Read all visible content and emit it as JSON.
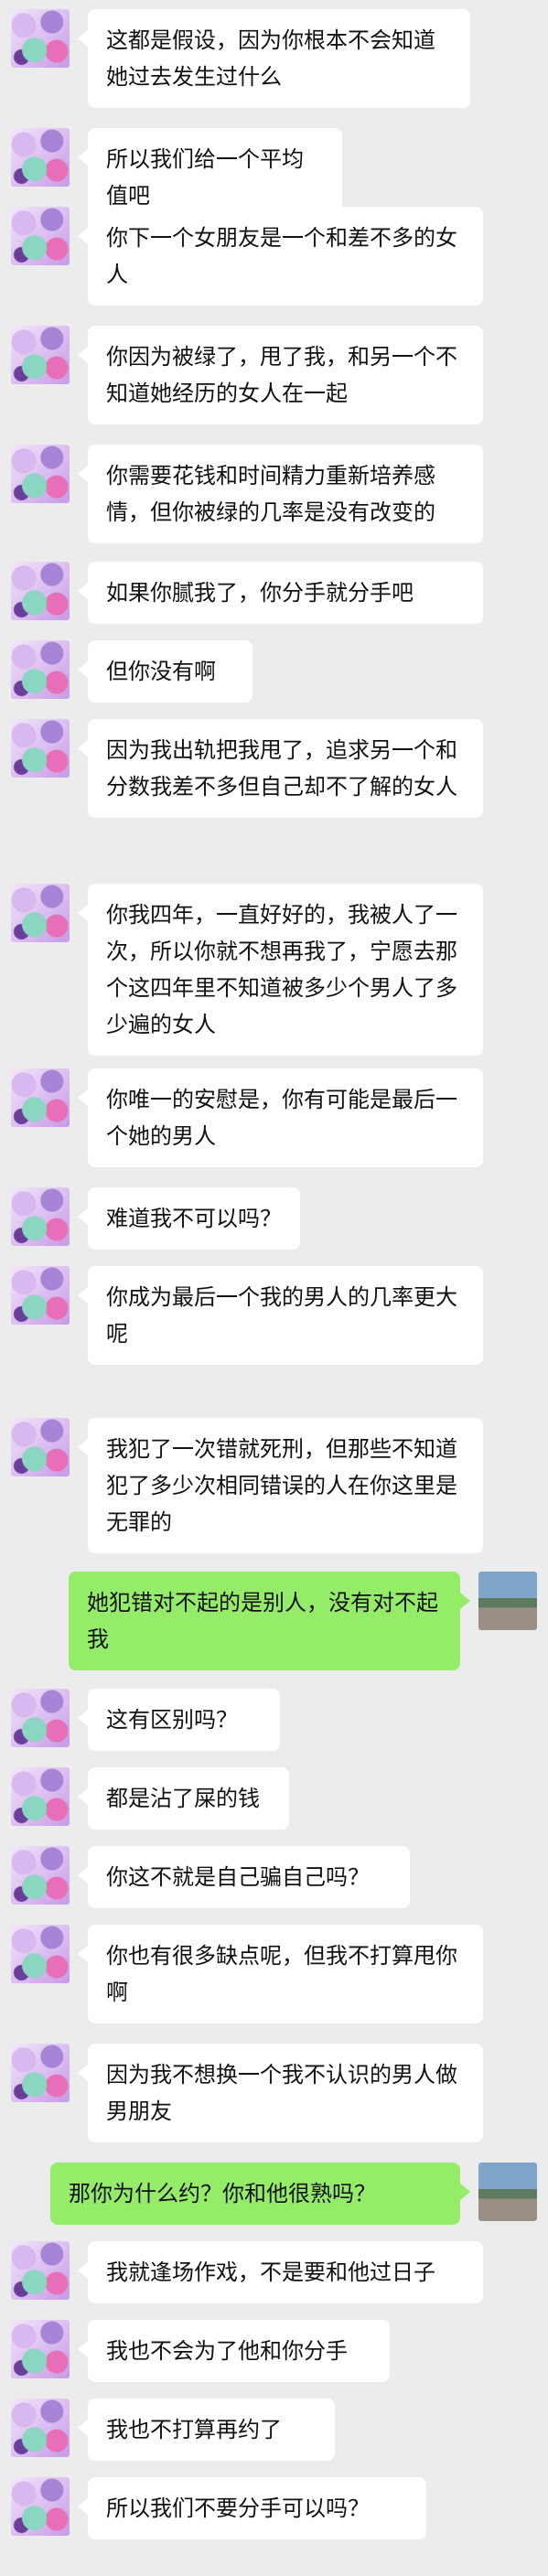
{
  "messages": [
    {
      "side": "left",
      "text": "这都是假设，因为你根本不会知道她过去发生过什么"
    },
    {
      "side": "left",
      "text": "所以我们给一个平均值吧"
    },
    {
      "side": "left",
      "text": "你下一个女朋友是一个和差不多的女人"
    },
    {
      "side": "left",
      "text": "你因为被绿了，甩了我，和另一个不知道她经历的女人在一起"
    },
    {
      "side": "left",
      "text": "你需要花钱和时间精力重新培养感情，但你被绿的几率是没有改变的"
    },
    {
      "side": "left",
      "text": "如果你腻我了，你分手就分手吧"
    },
    {
      "side": "left",
      "text": "但你没有啊"
    },
    {
      "side": "left",
      "text": "因为我出轨把我甩了，追求另一个和分数我差不多但自己却不了解的女人"
    },
    {
      "side": "left",
      "text": "你我四年，一直好好的，我被人了一次，所以你就不想再我了，宁愿去那个这四年里不知道被多少个男人了多少遍的女人"
    },
    {
      "side": "left",
      "text": "你唯一的安慰是，你有可能是最后一个她的男人"
    },
    {
      "side": "left",
      "text": "难道我不可以吗？"
    },
    {
      "side": "left",
      "text": "你成为最后一个我的男人的几率更大呢"
    },
    {
      "side": "left",
      "text": "我犯了一次错就死刑，但那些不知道犯了多少次相同错误的人在你这里是无罪的"
    },
    {
      "side": "right",
      "text": "她犯错对不起的是别人，没有对不起我"
    },
    {
      "side": "left",
      "text": "这有区别吗？"
    },
    {
      "side": "left",
      "text": "都是沾了屎的钱"
    },
    {
      "side": "left",
      "text": "你这不就是自己骗自己吗？"
    },
    {
      "side": "left",
      "text": "你也有很多缺点呢，但我不打算甩你啊"
    },
    {
      "side": "left",
      "text": "因为我不想换一个我不认识的男人做男朋友"
    },
    {
      "side": "right",
      "text": "那你为什么约？你和他很熟吗？"
    },
    {
      "side": "left",
      "text": "我就逢场作戏，不是要和他过日子"
    },
    {
      "side": "left",
      "text": "我也不会为了他和你分手"
    },
    {
      "side": "left",
      "text": "我也不打算再约了"
    },
    {
      "side": "left",
      "text": "所以我们不要分手可以吗？"
    }
  ]
}
